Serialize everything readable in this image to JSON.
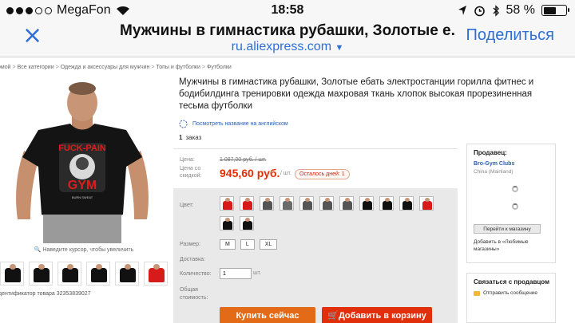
{
  "status_bar": {
    "carrier": "MegaFon",
    "time": "18:58",
    "battery": "58 %",
    "battery_level": 0.58,
    "signal_bars": 3,
    "icons": [
      "wifi-icon",
      "location-arrow-icon",
      "alarm-icon",
      "bluetooth-icon",
      "battery-icon"
    ]
  },
  "nav": {
    "close_icon": "×",
    "title": "Мужчины в гимнастика рубашки, Золотые е...",
    "url": "ru.aliexpress.com",
    "url_caret": "▼",
    "share_label": "Поделиться"
  },
  "breadcrumb": {
    "items": [
      "омой",
      "Все категории",
      "Одежда и аксессуары для мужчин",
      "Топы и футболки",
      "Футболки"
    ],
    "separator": ">"
  },
  "gallery": {
    "shirt_text_top": "FUCK-PAIN",
    "shirt_text_mid": "GYM",
    "shirt_text_small": "BURN SWEAT",
    "zoom_hint": "Наведите курсор, чтобы увеличить",
    "thumb_colors": [
      "#111111",
      "#111111",
      "#111111",
      "#111111",
      "#111111",
      "#d71a1a"
    ],
    "product_id": "дентификатор товара 32353839027"
  },
  "product": {
    "title": "Мужчины в гимнастика рубашки, Золотые ебать электростанции горилла фитнес и бодибилдинга тренировки одежда махровая ткань хлопок высокая прорезиненная тесьма футболки",
    "translate_link": "Посмотреть название на английском",
    "orders_count": "1",
    "orders_label": "заказ"
  },
  "price": {
    "price_label": "Цена:",
    "old_price": "1 087,00 руб. / шт.",
    "discount_label_1": "Цена со",
    "discount_label_2": "скидкой:",
    "new_price": "945,60 руб.",
    "per_unit": "/ шт.",
    "days_left": "Осталось дней: 1"
  },
  "options": {
    "color_label": "Цвет:",
    "swatch_colors": [
      "#d71a1a",
      "#d71a1a",
      "#555555",
      "#6a6a6a",
      "#555555",
      "#555555",
      "#555555",
      "#111111",
      "#111111",
      "#111111",
      "#d71a1a",
      "#111111",
      "#111111"
    ],
    "size_label": "Размер:",
    "sizes": [
      "M",
      "L",
      "XL"
    ],
    "shipping_label": "Доставка:",
    "quantity_label": "Количество:",
    "quantity_value": "1",
    "quantity_unit": "шт.",
    "total_label_1": "Общая",
    "total_label_2": "стоимость:",
    "buy_now": "Купить сейчас",
    "add_to_cart": "Добавить в корзину"
  },
  "seller": {
    "heading": "Продавец:",
    "name": "Bro-Gym Clubs",
    "country": "China (Mainland)",
    "store_button": "Перейти к магазину",
    "favorites_link": "Добавить в «Любимые магазины»"
  },
  "contact": {
    "heading": "Связаться с продавцом",
    "send_message": "Отправить сообщение"
  }
}
